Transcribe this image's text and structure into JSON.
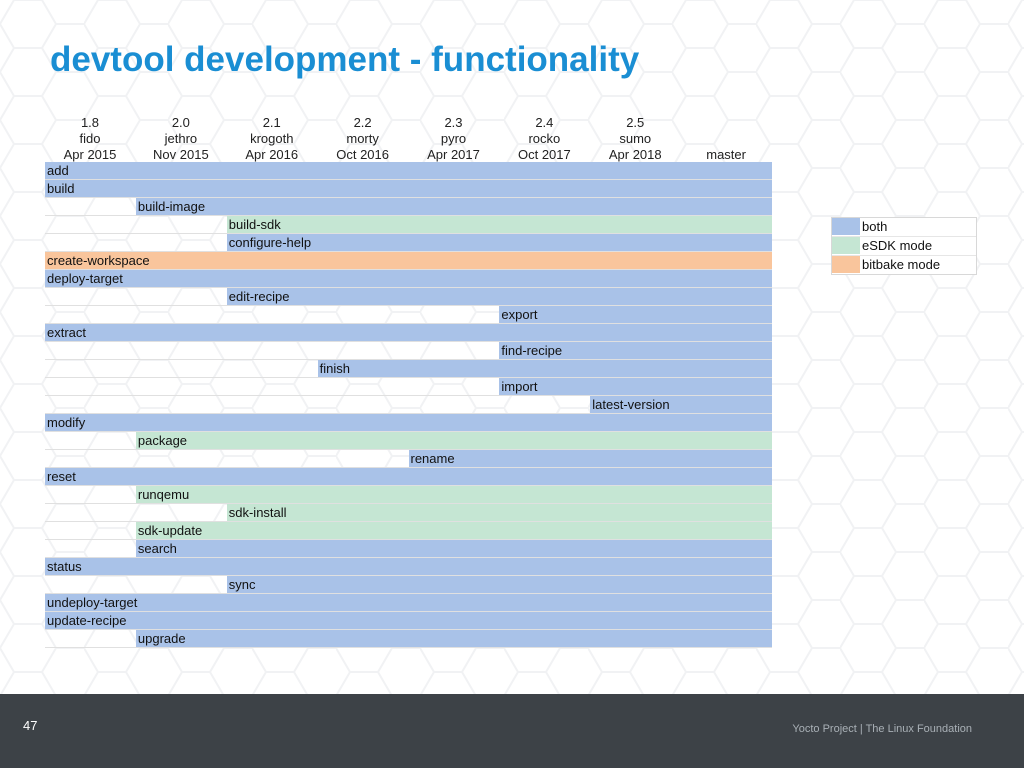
{
  "title": "devtool development - functionality",
  "colors": {
    "both": "#a9c2e8",
    "esdk": "#c5e6d3",
    "bitbake": "#f9c59c"
  },
  "versions": [
    {
      "number": "1.8",
      "codename": "fido",
      "date": "Apr 2015"
    },
    {
      "number": "2.0",
      "codename": "jethro",
      "date": "Nov 2015"
    },
    {
      "number": "2.1",
      "codename": "krogoth",
      "date": "Apr 2016"
    },
    {
      "number": "2.2",
      "codename": "morty",
      "date": "Oct 2016"
    },
    {
      "number": "2.3",
      "codename": "pyro",
      "date": "Apr 2017"
    },
    {
      "number": "2.4",
      "codename": "rocko",
      "date": "Oct 2017"
    },
    {
      "number": "2.5",
      "codename": "sumo",
      "date": "Apr 2018"
    },
    {
      "number": "",
      "codename": "",
      "date": "master"
    }
  ],
  "commands": [
    {
      "name": "add",
      "since": 0,
      "mode": "both"
    },
    {
      "name": "build",
      "since": 0,
      "mode": "both"
    },
    {
      "name": "build-image",
      "since": 1,
      "mode": "both"
    },
    {
      "name": "build-sdk",
      "since": 2,
      "mode": "esdk"
    },
    {
      "name": "configure-help",
      "since": 2,
      "mode": "both"
    },
    {
      "name": "create-workspace",
      "since": 0,
      "mode": "bitbake"
    },
    {
      "name": "deploy-target",
      "since": 0,
      "mode": "both"
    },
    {
      "name": "edit-recipe",
      "since": 2,
      "mode": "both"
    },
    {
      "name": "export",
      "since": 5,
      "mode": "both"
    },
    {
      "name": "extract",
      "since": 0,
      "mode": "both"
    },
    {
      "name": "find-recipe",
      "since": 5,
      "mode": "both"
    },
    {
      "name": "finish",
      "since": 3,
      "mode": "both"
    },
    {
      "name": "import",
      "since": 5,
      "mode": "both"
    },
    {
      "name": "latest-version",
      "since": 6,
      "mode": "both"
    },
    {
      "name": "modify",
      "since": 0,
      "mode": "both"
    },
    {
      "name": "package",
      "since": 1,
      "mode": "esdk"
    },
    {
      "name": "rename",
      "since": 4,
      "mode": "both"
    },
    {
      "name": "reset",
      "since": 0,
      "mode": "both"
    },
    {
      "name": "runqemu",
      "since": 1,
      "mode": "esdk"
    },
    {
      "name": "sdk-install",
      "since": 2,
      "mode": "esdk"
    },
    {
      "name": "sdk-update",
      "since": 1,
      "mode": "esdk"
    },
    {
      "name": "search",
      "since": 1,
      "mode": "both"
    },
    {
      "name": "status",
      "since": 0,
      "mode": "both"
    },
    {
      "name": "sync",
      "since": 2,
      "mode": "both"
    },
    {
      "name": "undeploy-target",
      "since": 0,
      "mode": "both"
    },
    {
      "name": "update-recipe",
      "since": 0,
      "mode": "both"
    },
    {
      "name": "upgrade",
      "since": 1,
      "mode": "both"
    }
  ],
  "legend": [
    {
      "label": "both",
      "mode": "both"
    },
    {
      "label": "eSDK mode",
      "mode": "esdk"
    },
    {
      "label": "bitbake mode",
      "mode": "bitbake"
    }
  ],
  "footer": {
    "page_number": "47",
    "text": "Yocto Project | The Linux Foundation"
  }
}
